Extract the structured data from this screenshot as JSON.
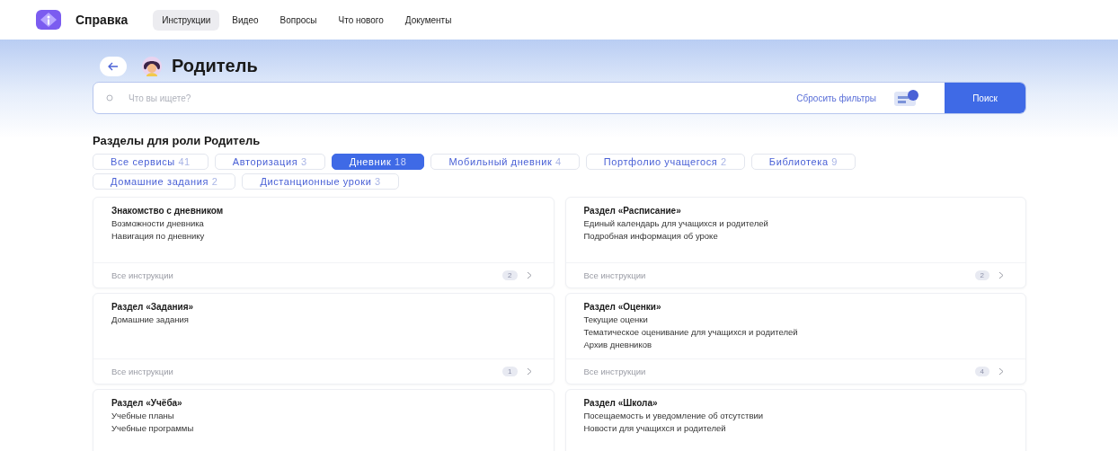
{
  "header": {
    "logo_text": "Справка",
    "nav": [
      {
        "label": "Инструкции",
        "selected": true
      },
      {
        "label": "Видео",
        "selected": false
      },
      {
        "label": "Вопросы",
        "selected": false
      },
      {
        "label": "Что нового",
        "selected": false
      },
      {
        "label": "Документы",
        "selected": false
      }
    ]
  },
  "page_title": "Родитель",
  "search": {
    "placeholder": "Что вы ищете?",
    "reset_label": "Сбросить фильтры",
    "button": "Поиск"
  },
  "sections_heading": "Разделы для роли Родитель",
  "filters": [
    {
      "label": "Все сервисы",
      "count": "41",
      "selected": false
    },
    {
      "label": "Авторизация",
      "count": "3",
      "selected": false
    },
    {
      "label": "Дневник",
      "count": "18",
      "selected": true
    },
    {
      "label": "Мобильный дневник",
      "count": "4",
      "selected": false
    },
    {
      "label": "Портфолио учащегося",
      "count": "2",
      "selected": false
    },
    {
      "label": "Библиотека",
      "count": "9",
      "selected": false
    },
    {
      "label": "Домашние задания",
      "count": "2",
      "selected": false
    },
    {
      "label": "Дистанционные уроки",
      "count": "3",
      "selected": false
    }
  ],
  "cards": [
    {
      "title": "Знакомство с дневником",
      "items": [
        "Возможности дневника",
        "Навигация по дневнику"
      ],
      "footer": {
        "label": "Все инструкции",
        "count": "2"
      }
    },
    {
      "title": "Раздел «Расписание»",
      "items": [
        "Единый календарь для учащихся и родителей",
        "Подробная информация об уроке"
      ],
      "footer": {
        "label": "Все инструкции",
        "count": "2"
      }
    },
    {
      "title": "Раздел «Задания»",
      "items": [
        "Домашние задания"
      ],
      "footer": {
        "label": "Все инструкции",
        "count": "1"
      }
    },
    {
      "title": "Раздел «Оценки»",
      "items": [
        "Текущие оценки",
        "Тематическое оценивание для учащихся и родителей",
        "Архив дневников"
      ],
      "footer": {
        "label": "Все инструкции",
        "count": "4"
      }
    },
    {
      "title": "Раздел «Учёба»",
      "items": [
        "Учебные планы",
        "Учебные программы"
      ]
    },
    {
      "title": "Раздел «Школа»",
      "items": [
        "Посещаемость и уведомление об отсутствии",
        "Новости для учащихся и родителей"
      ]
    }
  ]
}
